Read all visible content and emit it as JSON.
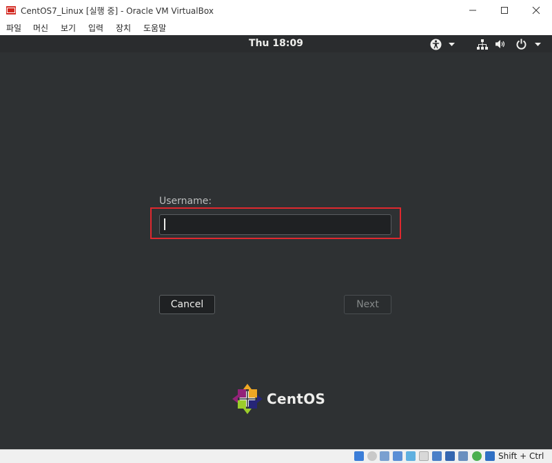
{
  "window": {
    "title": "CentOS7_Linux [실행 중] - Oracle VM VirtualBox"
  },
  "menu": {
    "items": [
      "파일",
      "머신",
      "보기",
      "입력",
      "장치",
      "도움말"
    ]
  },
  "gnome_topbar": {
    "clock": "Thu 18:09"
  },
  "login": {
    "username_label": "Username:",
    "username_value": "",
    "cancel_label": "Cancel",
    "next_label": "Next"
  },
  "branding": {
    "logo_text": "CentOS"
  },
  "statusbar": {
    "host_key": "Shift + Ctrl"
  },
  "colors": {
    "screen_bg": "#2e3133",
    "highlight": "#e0282e",
    "text_light": "#eeeeec"
  },
  "icons": [
    "virtualbox-icon",
    "minimize-icon",
    "maximize-icon",
    "close-icon",
    "accessibility-icon",
    "network-icon",
    "volume-icon",
    "power-icon",
    "chevron-down-icon",
    "centos-logo-icon"
  ]
}
